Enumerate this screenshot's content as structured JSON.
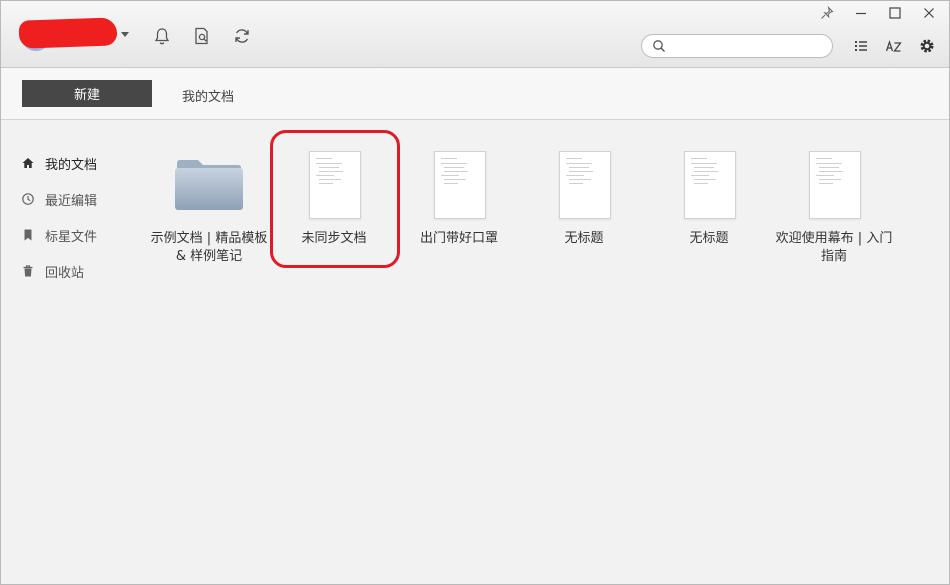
{
  "header": {
    "icons": [
      "bell-icon",
      "doc-search-icon",
      "sync-icon"
    ],
    "search": {
      "value": "",
      "placeholder": ""
    },
    "right_icons": [
      "list-view-icon",
      "sort-az-icon",
      "settings-gear-icon"
    ],
    "window_controls": [
      "pin-icon",
      "minimize-icon",
      "maximize-icon",
      "close-icon"
    ]
  },
  "toolbar": {
    "new_label": "新建",
    "breadcrumb": "我的文档"
  },
  "sidebar": {
    "items": [
      {
        "label": "我的文档",
        "icon": "home-icon",
        "active": true
      },
      {
        "label": "最近编辑",
        "icon": "clock-icon",
        "active": false
      },
      {
        "label": "标星文件",
        "icon": "bookmark-icon",
        "active": false
      },
      {
        "label": "回收站",
        "icon": "trash-icon",
        "active": false
      }
    ]
  },
  "files": [
    {
      "type": "folder",
      "label": "示例文档 | 精品模板 & 样例笔记"
    },
    {
      "type": "document",
      "label": "未同步文档",
      "highlighted": true
    },
    {
      "type": "document",
      "label": "出门带好口罩"
    },
    {
      "type": "document",
      "label": "无标题"
    },
    {
      "type": "document",
      "label": "无标题"
    },
    {
      "type": "document",
      "label": "欢迎使用幕布 | 入门指南"
    }
  ],
  "colors": {
    "new_button": "#474747",
    "highlight": "#e01b25",
    "avatar_redaction": "#ef1f1f"
  }
}
